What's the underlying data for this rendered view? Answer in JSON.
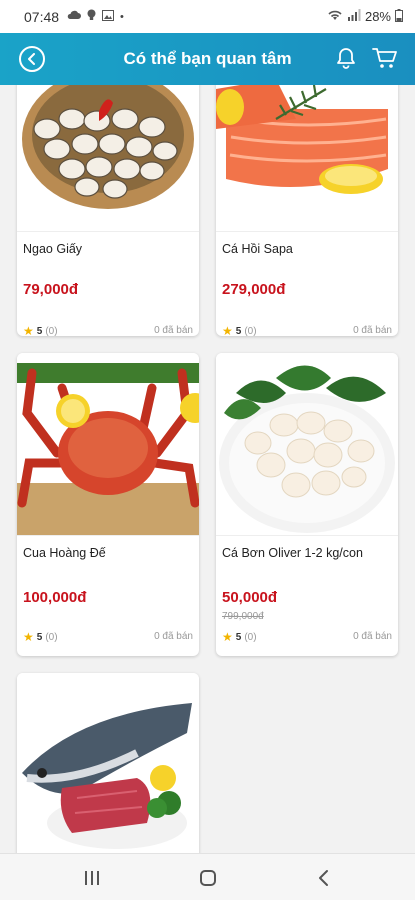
{
  "status": {
    "time": "07:48",
    "battery": "28%"
  },
  "header": {
    "title": "Có thể bạn quan tâm"
  },
  "products": [
    {
      "name": "Ngao Giấy",
      "price": "79,000đ",
      "old_price": "",
      "rating": "5",
      "rating_count": "(0)",
      "sold": "0 đã bán"
    },
    {
      "name": "Cá Hồi Sapa",
      "price": "279,000đ",
      "old_price": "",
      "rating": "5",
      "rating_count": "(0)",
      "sold": "0 đã bán"
    },
    {
      "name": "Cua Hoàng Đế",
      "price": "100,000đ",
      "old_price": "",
      "rating": "5",
      "rating_count": "(0)",
      "sold": "0 đã bán"
    },
    {
      "name": "Cá Bơn Oliver 1-2 kg/con",
      "price": "50,000đ",
      "old_price": "799,000đ",
      "rating": "5",
      "rating_count": "(0)",
      "sold": "0 đã bán"
    },
    {
      "name": "",
      "price": "",
      "old_price": "",
      "rating": "",
      "rating_count": "",
      "sold": ""
    }
  ],
  "colors": {
    "header": "#1a9bc6",
    "price": "#c8131d",
    "star": "#f2b400"
  },
  "icons": {
    "back": "back-circle-icon",
    "bell": "bell-icon",
    "cart": "cart-icon",
    "nav_recent": "recent-apps-icon",
    "nav_home": "home-icon",
    "nav_back": "nav-back-icon"
  }
}
